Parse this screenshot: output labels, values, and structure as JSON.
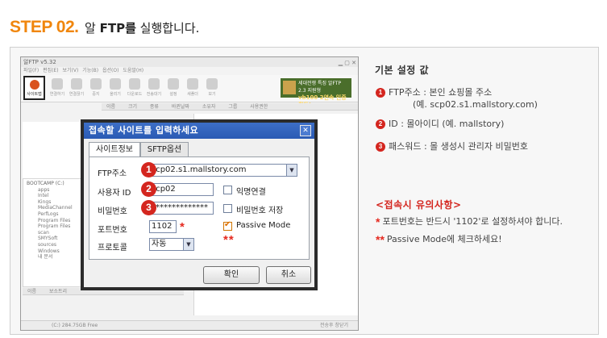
{
  "header": {
    "step": "STEP 02.",
    "title_pre": "알",
    "title_bold": "FTP를",
    "title_post": "실행합니다."
  },
  "app": {
    "window_title": "알FTP v5.32",
    "menu": "파일(F)  편집(E)  보기(V)  기능(B)  옵션(O)  도움말(H)",
    "toolbar": [
      {
        "label": "사이트맵",
        "icon": "sitemap-icon"
      },
      {
        "label": "연결하기",
        "icon": "connect-icon"
      },
      {
        "label": "연결끊기",
        "icon": "disconnect-icon"
      },
      {
        "label": "중지",
        "icon": "stop-icon"
      },
      {
        "label": "올리기",
        "icon": "upload-icon"
      },
      {
        "label": "다운로드",
        "icon": "download-icon"
      },
      {
        "label": "전송대기",
        "icon": "queue-icon"
      },
      {
        "label": "설정",
        "icon": "settings-icon"
      },
      {
        "label": "새폴더",
        "icon": "new-folder-icon"
      },
      {
        "label": "보기",
        "icon": "view-icon"
      }
    ],
    "banner_line1": "세대전쟁 특징 알FTP 2.3 지원형",
    "banner_line2": "vb100 2연속 인증획득!",
    "remote_header": "이름  크기  종류  바뀐날짜  소유자  그룹  사용권한",
    "tree": {
      "drive": "BOOTCAMP (C:)",
      "items": [
        "apps",
        "Intel",
        "Kings",
        "MediaChannel",
        "PerfLogs",
        "Program Files",
        "Program Files",
        "scan",
        "SMYSoft",
        "sources",
        "Windows",
        "내 문서"
      ]
    },
    "local_header": "이름  보소트리",
    "status_left": "(C:)  284.75GB Free",
    "status_right": "전송후 창닫기"
  },
  "dialog": {
    "title": "접속할 사이트를 입력하세요",
    "tabs": [
      "사이트정보",
      "SFTP옵션"
    ],
    "ftp_label": "FTP주소",
    "ftp_value": "scp02.s1.mallstory.com",
    "user_label": "사용자 ID",
    "user_value": "scp02",
    "pw_label": "비밀번호",
    "pw_value": "**************",
    "port_label": "포트번호",
    "port_value": "1102",
    "protocol_label": "프로토콜",
    "protocol_value": "자동",
    "anon_label": "익명연결",
    "savepw_label": "비밀번호 저장",
    "passive_label": "Passive Mode",
    "passive_checked": true,
    "ok_button": "확인",
    "cancel_button": "취소",
    "badges": [
      "1",
      "2",
      "3"
    ],
    "star_single": "*",
    "star_double": "**"
  },
  "info": {
    "title": "기본 설정 값",
    "items": [
      {
        "num": "1",
        "text": "FTP주소 : 본인 쇼핑몰 주소",
        "sub": "(예. scp02.s1.mallstory.com)"
      },
      {
        "num": "2",
        "text": "ID : 몰아이디 (예. mallstory)"
      },
      {
        "num": "3",
        "text": "패스워드 : 몰 생성시 관리자 비밀번호"
      }
    ],
    "caution_title": "<접속시 유의사항>",
    "notes": [
      {
        "star": "*",
        "text": "포트번호는 반드시 '1102'로 설정하셔야 합니다."
      },
      {
        "star": "**",
        "text": "Passive Mode에 체크하세요!"
      }
    ]
  },
  "colors": {
    "accent_orange": "#f0860d",
    "badge_red": "#d4261f",
    "dialog_title_blue": "#2a5ab4"
  }
}
